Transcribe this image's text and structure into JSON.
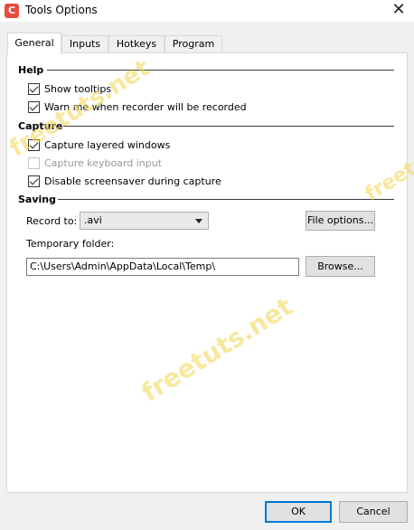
{
  "window": {
    "title": "Tools Options",
    "app_icon_letter": "C"
  },
  "tabs": [
    {
      "label": "General",
      "active": true
    },
    {
      "label": "Inputs",
      "active": false
    },
    {
      "label": "Hotkeys",
      "active": false
    },
    {
      "label": "Program",
      "active": false
    }
  ],
  "help": {
    "heading": "Help",
    "show_tooltips": {
      "label": "Show tooltips",
      "checked": true
    },
    "warn_recorded": {
      "label": "Warn me when recorder will be recorded",
      "checked": true
    }
  },
  "capture": {
    "heading": "Capture",
    "layered_windows": {
      "label": "Capture layered windows",
      "checked": true
    },
    "keyboard_input": {
      "label": "Capture keyboard input",
      "checked": false,
      "disabled": true
    },
    "disable_screensaver": {
      "label": "Disable screensaver during capture",
      "checked": true
    }
  },
  "saving": {
    "heading": "Saving",
    "record_to_label": "Record to:",
    "record_to_value": ".avi",
    "file_options_button": "File options...",
    "temp_folder_label": "Temporary folder:",
    "temp_folder_value": "C:\\Users\\Admin\\AppData\\Local\\Temp\\",
    "browse_button": "Browse..."
  },
  "footer": {
    "ok_button": "OK",
    "cancel_button": "Cancel"
  },
  "watermark": "freetuts.net",
  "colors": {
    "app_icon": "#e84c3d",
    "default_button_border": "#0078d7",
    "watermark": "#f1d74f"
  }
}
